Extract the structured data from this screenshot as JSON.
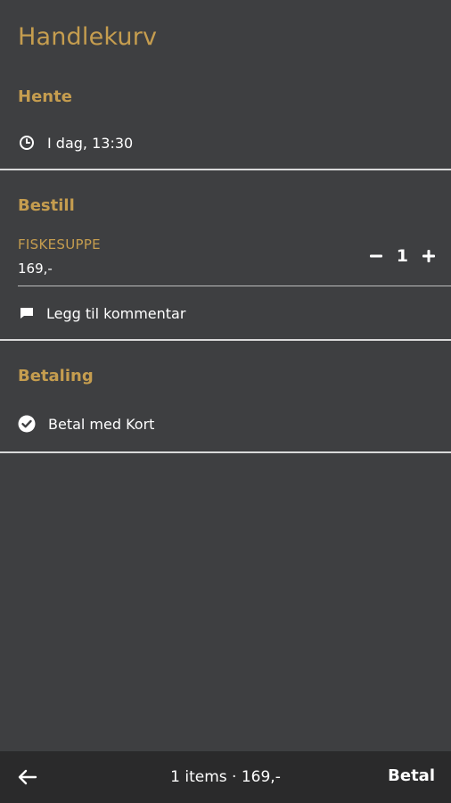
{
  "header": {
    "title": "Handlekurv"
  },
  "pickup": {
    "title": "Hente",
    "time": "I dag, 13:30",
    "icon": "clock-icon"
  },
  "order": {
    "title": "Bestill",
    "item": {
      "name": "FISKESUPPE",
      "price": "169,-",
      "quantity": "1",
      "decrement_icon": "minus-icon",
      "increment_icon": "plus-icon"
    },
    "comment": {
      "label": "Legg til kommentar",
      "icon": "comment-icon"
    }
  },
  "payment": {
    "title": "Betaling",
    "method": "Betal med Kort",
    "icon": "check-circle-icon"
  },
  "footer": {
    "summary": "1 items · 169,-",
    "pay_label": "Betal",
    "back_icon": "arrow-left-icon"
  },
  "colors": {
    "background": "#3e3f41",
    "accent": "#c59d4f",
    "bottom_bar": "#2a2a2b",
    "text": "#ffffff"
  }
}
